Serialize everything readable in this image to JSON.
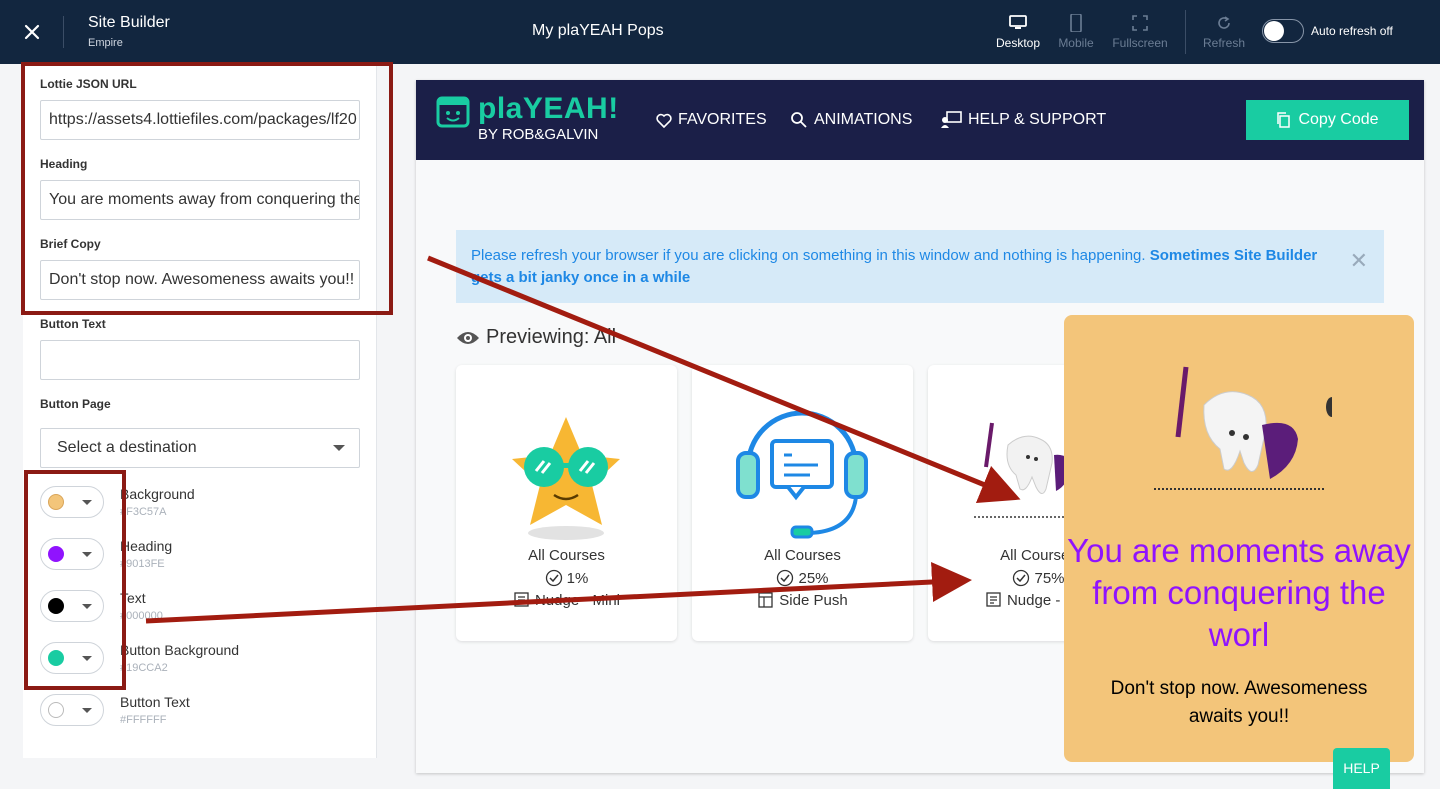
{
  "topbar": {
    "title": "Site Builder",
    "subtitle": "Empire",
    "page_name": "My plaYEAH Pops",
    "views": [
      {
        "label": "Desktop",
        "icon": "desktop-icon",
        "active": true
      },
      {
        "label": "Mobile",
        "icon": "mobile-icon",
        "active": false
      },
      {
        "label": "Fullscreen",
        "icon": "fullscreen-icon",
        "active": false
      }
    ],
    "refresh_label": "Refresh",
    "auto_refresh_label": "Auto refresh off"
  },
  "form": {
    "lottie_label": "Lottie JSON URL",
    "lottie_value": "https://assets4.lottiefiles.com/packages/lf20",
    "heading_label": "Heading",
    "heading_value": "You are moments away from conquering the world",
    "brief_label": "Brief Copy",
    "brief_value": "Don't stop now. Awesomeness awaits you!!",
    "button_text_label": "Button Text",
    "button_text_value": "",
    "button_page_label": "Button Page",
    "button_page_placeholder": "Select a destination"
  },
  "colors": [
    {
      "name": "Background",
      "hex": "#F3C57A",
      "swatch": "#f3c57a"
    },
    {
      "name": "Heading",
      "hex": "#9013FE",
      "swatch": "#9013fe"
    },
    {
      "name": "Text",
      "hex": "#000000",
      "swatch": "#000000"
    },
    {
      "name": "Button Background",
      "hex": "#19CCA2",
      "swatch": "#19cca2"
    },
    {
      "name": "Button Text",
      "hex": "#FFFFFF",
      "swatch": "#ffffff"
    }
  ],
  "preview": {
    "logo_text": "plaYEAH!",
    "logo_sub": "BY ROB&GALVIN",
    "nav": [
      {
        "label": "FAVORITES",
        "icon": "heart-icon"
      },
      {
        "label": "ANIMATIONS",
        "icon": "search-icon"
      },
      {
        "label": "HELP & SUPPORT",
        "icon": "support-icon"
      }
    ],
    "copy_code": "Copy Code",
    "alert_text": "Please refresh your browser if you are clicking on something in this window and nothing is happening.",
    "alert_bold": "Sometimes Site Builder gets a bit janky once in a while",
    "previewing": "Previewing: All",
    "cards": [
      {
        "title": "All Courses",
        "percent": "1%",
        "type": "Nudge - Mini",
        "art": "star-sunglasses-icon"
      },
      {
        "title": "All Courses",
        "percent": "25%",
        "type": "Side Push",
        "art": "headset-chat-icon"
      },
      {
        "title": "All Courses",
        "percent": "75%",
        "type": "Nudge - Mini",
        "art": "tooth-warrior-icon"
      }
    ]
  },
  "popup": {
    "heading": "You are moments away from conquering the worl",
    "copy": "Don't stop now. Awesomeness awaits you!!"
  },
  "help_label": "HELP"
}
